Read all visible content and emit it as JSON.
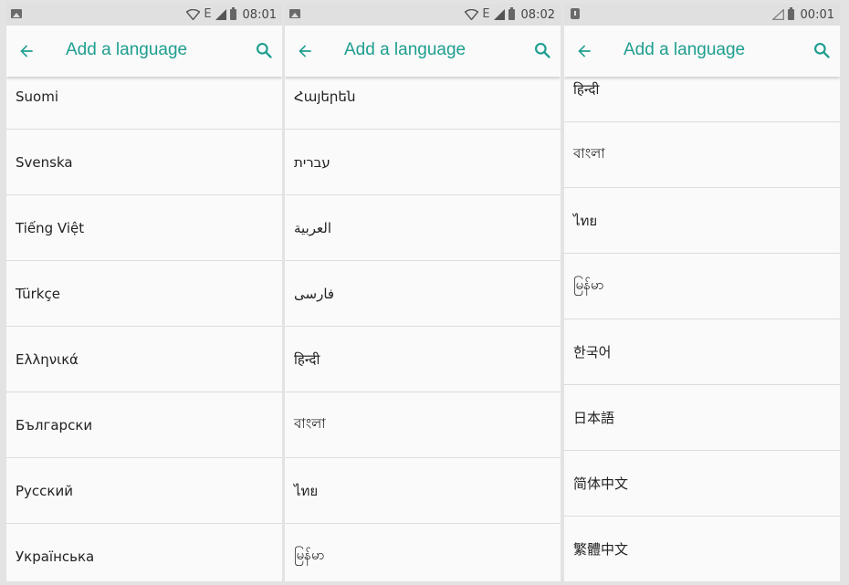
{
  "colors": {
    "accent": "#1e9e8f",
    "background": "#fafafa",
    "statusbar": "#e0e0e0"
  },
  "screens": [
    {
      "status": {
        "notification_icon": "image-icon",
        "network": "E",
        "time": "08:01"
      },
      "header": {
        "title": "Add a language",
        "back_icon": "arrow-back-icon",
        "search_icon": "search-icon"
      },
      "languages": [
        "Suomi",
        "Svenska",
        "Tiếng Việt",
        "Türkçe",
        "Ελληνικά",
        "Български",
        "Русский",
        "Українська"
      ]
    },
    {
      "status": {
        "notification_icon": "image-icon",
        "network": "E",
        "time": "08:02"
      },
      "header": {
        "title": "Add a language",
        "back_icon": "arrow-back-icon",
        "search_icon": "search-icon"
      },
      "languages": [
        "Հայերեն",
        "עברית",
        "العربية",
        "فارسی",
        "हिन्दी",
        "বাংলা",
        "ไทย",
        "မြန်မာ"
      ]
    },
    {
      "status": {
        "notification_icon": "alert-icon",
        "network": "",
        "time": "00:01"
      },
      "header": {
        "title": "Add a language",
        "back_icon": "arrow-back-icon",
        "search_icon": "search-icon"
      },
      "languages": [
        "हिन्दी",
        "বাংলা",
        "ไทย",
        "မြန်မာ",
        "한국어",
        "日本語",
        "简体中文",
        "繁體中文"
      ]
    }
  ]
}
